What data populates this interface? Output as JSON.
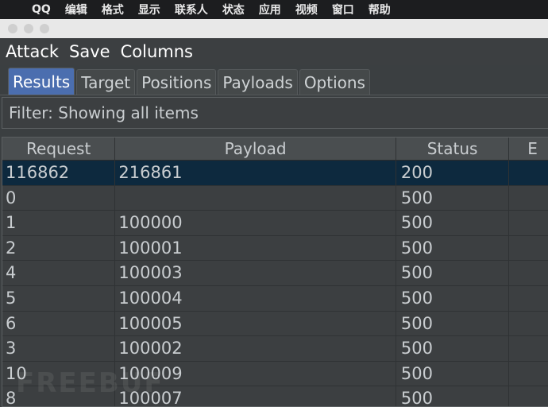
{
  "menubar": {
    "apple": "",
    "items": [
      "QQ",
      "编辑",
      "格式",
      "显示",
      "联系人",
      "状态",
      "应用",
      "视频",
      "窗口",
      "帮助"
    ]
  },
  "app_menu": [
    "Attack",
    "Save",
    "Columns"
  ],
  "tabs": [
    "Results",
    "Target",
    "Positions",
    "Payloads",
    "Options"
  ],
  "filter_text": "Filter: Showing all items",
  "table": {
    "columns": [
      "Request",
      "Payload",
      "Status",
      "E"
    ],
    "rows": [
      [
        "116862",
        "216861",
        "200",
        ""
      ],
      [
        "0",
        "",
        "500",
        ""
      ],
      [
        "1",
        "100000",
        "500",
        ""
      ],
      [
        "2",
        "100001",
        "500",
        ""
      ],
      [
        "4",
        "100003",
        "500",
        ""
      ],
      [
        "5",
        "100004",
        "500",
        ""
      ],
      [
        "6",
        "100005",
        "500",
        ""
      ],
      [
        "3",
        "100002",
        "500",
        ""
      ],
      [
        "10",
        "100009",
        "500",
        ""
      ],
      [
        "8",
        "100007",
        "500",
        ""
      ]
    ]
  },
  "watermark": "FREEBUF",
  "colors": {
    "selected_row": "#0d293e",
    "active_tab": "#4b6eaf"
  }
}
